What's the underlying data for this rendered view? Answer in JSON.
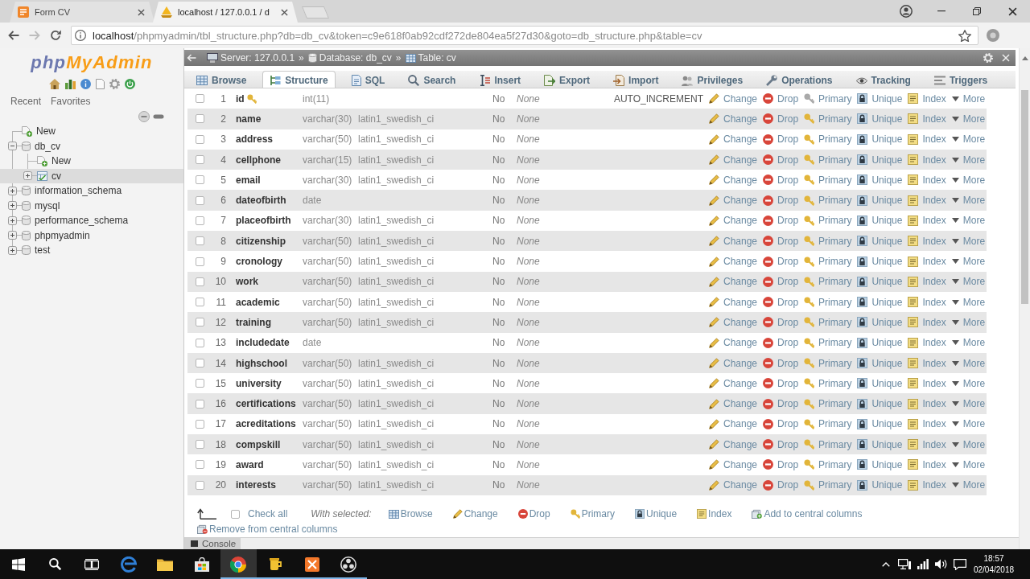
{
  "browser": {
    "tabs": [
      {
        "title": "Form CV",
        "selected": false
      },
      {
        "title": "localhost / 127.0.0.1 / d",
        "selected": true
      }
    ],
    "nav_buttons": [
      {
        "disabled": false
      },
      {
        "disabled": true
      },
      {
        "disabled": false
      }
    ],
    "address": {
      "host": "localhost",
      "path": "/phpmyadmin/tbl_structure.php?db=db_cv&token=c9e618f0ab92cdf272de804ea5f27d30&goto=db_structure.php&table=cv"
    }
  },
  "sidebar": {
    "logo": {
      "part_1": "php",
      "part_2": "MyAdmin"
    },
    "tabs": [
      "Recent",
      "Favorites"
    ],
    "tree": [
      {
        "kind": "new",
        "label": "New",
        "selected": false
      },
      {
        "kind": "database",
        "label": "db_cv",
        "expanded": true,
        "selected": false,
        "children": [
          {
            "kind": "new",
            "label": "New",
            "selected": false
          },
          {
            "kind": "table",
            "label": "cv",
            "expanded": false,
            "selected": true
          }
        ]
      },
      {
        "kind": "database",
        "label": "information_schema",
        "expanded": false,
        "selected": false
      },
      {
        "kind": "database",
        "label": "mysql",
        "expanded": false,
        "selected": false
      },
      {
        "kind": "database",
        "label": "performance_schema",
        "expanded": false,
        "selected": false
      },
      {
        "kind": "database",
        "label": "phpmyadmin",
        "expanded": false,
        "selected": false
      },
      {
        "kind": "database",
        "label": "test",
        "expanded": false,
        "selected": false
      }
    ]
  },
  "breadcrumb": [
    {
      "label": "Server: 127.0.0.1",
      "separator": "»"
    },
    {
      "label": "Database: db_cv",
      "separator": "»"
    },
    {
      "label": "Table: cv"
    }
  ],
  "tabs": [
    {
      "label": "Browse",
      "selected": false
    },
    {
      "label": "Structure",
      "selected": true
    },
    {
      "label": "SQL",
      "selected": false
    },
    {
      "label": "Search",
      "selected": false
    },
    {
      "label": "Insert",
      "selected": false
    },
    {
      "label": "Export",
      "selected": false
    },
    {
      "label": "Import",
      "selected": false
    },
    {
      "label": "Privileges",
      "selected": false
    },
    {
      "label": "Operations",
      "selected": false
    },
    {
      "label": "Tracking",
      "selected": false
    },
    {
      "label": "Triggers",
      "selected": false
    }
  ],
  "table": {
    "rows": [
      {
        "checked": false,
        "number": "1",
        "name": "id",
        "primary_key": true,
        "type": "int(11)",
        "null": "No",
        "default": "None",
        "extra": "AUTO_INCREMENT",
        "actions": [
          "Change",
          "Drop",
          "Primary",
          "Unique",
          "Index",
          "More"
        ]
      },
      {
        "checked": false,
        "number": "2",
        "name": "name",
        "primary_key": false,
        "type": "varchar(30)",
        "collation": "latin1_swedish_ci",
        "null": "No",
        "default": "None",
        "actions": [
          "Change",
          "Drop",
          "Primary",
          "Unique",
          "Index",
          "More"
        ]
      },
      {
        "checked": false,
        "number": "3",
        "name": "address",
        "primary_key": false,
        "type": "varchar(50)",
        "collation": "latin1_swedish_ci",
        "null": "No",
        "default": "None",
        "actions": [
          "Change",
          "Drop",
          "Primary",
          "Unique",
          "Index",
          "More"
        ]
      },
      {
        "checked": false,
        "number": "4",
        "name": "cellphone",
        "primary_key": false,
        "type": "varchar(15)",
        "collation": "latin1_swedish_ci",
        "null": "No",
        "default": "None",
        "actions": [
          "Change",
          "Drop",
          "Primary",
          "Unique",
          "Index",
          "More"
        ]
      },
      {
        "checked": false,
        "number": "5",
        "name": "email",
        "primary_key": false,
        "type": "varchar(30)",
        "collation": "latin1_swedish_ci",
        "null": "No",
        "default": "None",
        "actions": [
          "Change",
          "Drop",
          "Primary",
          "Unique",
          "Index",
          "More"
        ]
      },
      {
        "checked": false,
        "number": "6",
        "name": "dateofbirth",
        "primary_key": false,
        "type": "date",
        "null": "No",
        "default": "None",
        "actions": [
          "Change",
          "Drop",
          "Primary",
          "Unique",
          "Index",
          "More"
        ]
      },
      {
        "checked": false,
        "number": "7",
        "name": "placeofbirth",
        "primary_key": false,
        "type": "varchar(30)",
        "collation": "latin1_swedish_ci",
        "null": "No",
        "default": "None",
        "actions": [
          "Change",
          "Drop",
          "Primary",
          "Unique",
          "Index",
          "More"
        ]
      },
      {
        "checked": false,
        "number": "8",
        "name": "citizenship",
        "primary_key": false,
        "type": "varchar(50)",
        "collation": "latin1_swedish_ci",
        "null": "No",
        "default": "None",
        "actions": [
          "Change",
          "Drop",
          "Primary",
          "Unique",
          "Index",
          "More"
        ]
      },
      {
        "checked": false,
        "number": "9",
        "name": "cronology",
        "primary_key": false,
        "type": "varchar(50)",
        "collation": "latin1_swedish_ci",
        "null": "No",
        "default": "None",
        "actions": [
          "Change",
          "Drop",
          "Primary",
          "Unique",
          "Index",
          "More"
        ]
      },
      {
        "checked": false,
        "number": "10",
        "name": "work",
        "primary_key": false,
        "type": "varchar(50)",
        "collation": "latin1_swedish_ci",
        "null": "No",
        "default": "None",
        "actions": [
          "Change",
          "Drop",
          "Primary",
          "Unique",
          "Index",
          "More"
        ]
      },
      {
        "checked": false,
        "number": "11",
        "name": "academic",
        "primary_key": false,
        "type": "varchar(50)",
        "collation": "latin1_swedish_ci",
        "null": "No",
        "default": "None",
        "actions": [
          "Change",
          "Drop",
          "Primary",
          "Unique",
          "Index",
          "More"
        ]
      },
      {
        "checked": false,
        "number": "12",
        "name": "training",
        "primary_key": false,
        "type": "varchar(50)",
        "collation": "latin1_swedish_ci",
        "null": "No",
        "default": "None",
        "actions": [
          "Change",
          "Drop",
          "Primary",
          "Unique",
          "Index",
          "More"
        ]
      },
      {
        "checked": false,
        "number": "13",
        "name": "includedate",
        "primary_key": false,
        "type": "date",
        "null": "No",
        "default": "None",
        "actions": [
          "Change",
          "Drop",
          "Primary",
          "Unique",
          "Index",
          "More"
        ]
      },
      {
        "checked": false,
        "number": "14",
        "name": "highschool",
        "primary_key": false,
        "type": "varchar(50)",
        "collation": "latin1_swedish_ci",
        "null": "No",
        "default": "None",
        "actions": [
          "Change",
          "Drop",
          "Primary",
          "Unique",
          "Index",
          "More"
        ]
      },
      {
        "checked": false,
        "number": "15",
        "name": "university",
        "primary_key": false,
        "type": "varchar(50)",
        "collation": "latin1_swedish_ci",
        "null": "No",
        "default": "None",
        "actions": [
          "Change",
          "Drop",
          "Primary",
          "Unique",
          "Index",
          "More"
        ]
      },
      {
        "checked": false,
        "number": "16",
        "name": "certifications",
        "primary_key": false,
        "type": "varchar(50)",
        "collation": "latin1_swedish_ci",
        "null": "No",
        "default": "None",
        "actions": [
          "Change",
          "Drop",
          "Primary",
          "Unique",
          "Index",
          "More"
        ]
      },
      {
        "checked": false,
        "number": "17",
        "name": "acreditations",
        "primary_key": false,
        "type": "varchar(50)",
        "collation": "latin1_swedish_ci",
        "null": "No",
        "default": "None",
        "actions": [
          "Change",
          "Drop",
          "Primary",
          "Unique",
          "Index",
          "More"
        ]
      },
      {
        "checked": false,
        "number": "18",
        "name": "compskill",
        "primary_key": false,
        "type": "varchar(50)",
        "collation": "latin1_swedish_ci",
        "null": "No",
        "default": "None",
        "actions": [
          "Change",
          "Drop",
          "Primary",
          "Unique",
          "Index",
          "More"
        ]
      },
      {
        "checked": false,
        "number": "19",
        "name": "award",
        "primary_key": false,
        "type": "varchar(50)",
        "collation": "latin1_swedish_ci",
        "null": "No",
        "default": "None",
        "actions": [
          "Change",
          "Drop",
          "Primary",
          "Unique",
          "Index",
          "More"
        ]
      },
      {
        "checked": false,
        "number": "20",
        "name": "interests",
        "primary_key": false,
        "type": "varchar(50)",
        "collation": "latin1_swedish_ci",
        "null": "No",
        "default": "None",
        "actions": [
          "Change",
          "Drop",
          "Primary",
          "Unique",
          "Index",
          "More"
        ]
      }
    ]
  },
  "footer": {
    "check_all": {
      "label": "Check all",
      "checked": false
    },
    "with_selected": "With selected:",
    "actions": [
      "Browse",
      "Change",
      "Drop",
      "Primary",
      "Unique",
      "Index",
      "Add to central columns",
      "Remove from central columns"
    ]
  },
  "console": {
    "label": "Console"
  },
  "taskbar": {
    "apps": [
      {
        "running": false,
        "selected": false
      },
      {
        "running": false,
        "selected": false
      },
      {
        "running": false,
        "selected": false
      },
      {
        "running": true,
        "selected": true
      },
      {
        "running": true,
        "selected": false
      },
      {
        "running": true,
        "selected": false
      },
      {
        "running": true,
        "selected": false
      }
    ],
    "time": "18:57",
    "date": "02/04/2018"
  }
}
